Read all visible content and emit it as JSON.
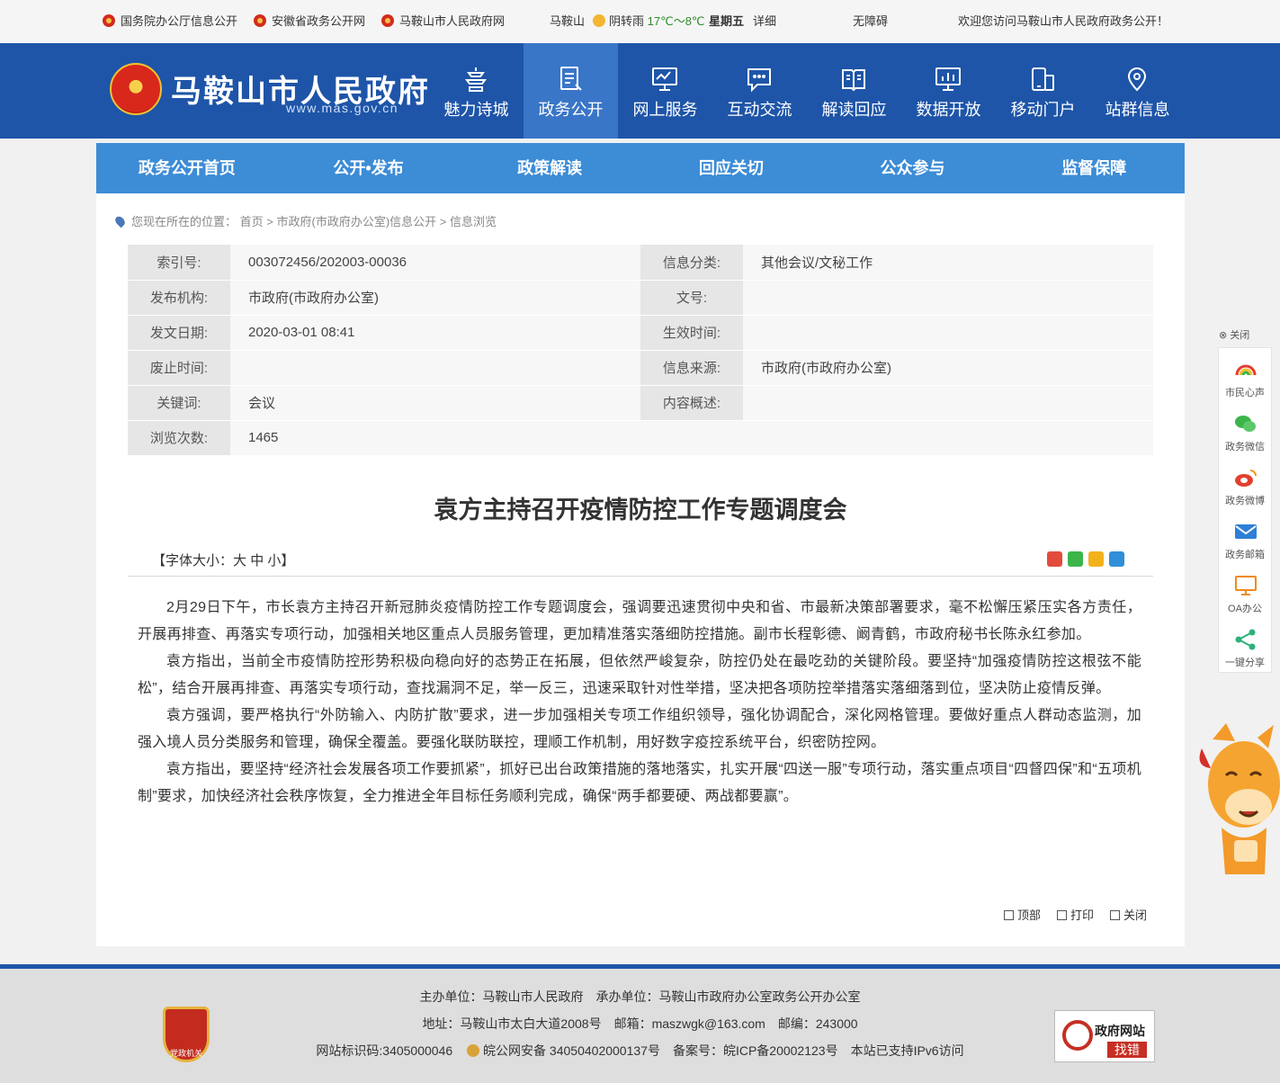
{
  "topbar": {
    "link1": "国务院办公厅信息公开",
    "link2": "安徽省政务公开网",
    "link3": "马鞍山市人民政府网",
    "city": "马鞍山",
    "weather": "阴转雨",
    "temp": "17℃～8℃",
    "weekday": "星期五",
    "detail": "详细",
    "accessibility": "无障碍",
    "welcome": "欢迎您访问马鞍山市人民政府政务公开！"
  },
  "header": {
    "title": "马鞍山市人民政府",
    "url": "www.mas.gov.cn",
    "nav": [
      {
        "label": "魅力诗城"
      },
      {
        "label": "政务公开"
      },
      {
        "label": "网上服务"
      },
      {
        "label": "互动交流"
      },
      {
        "label": "解读回应"
      },
      {
        "label": "数据开放"
      },
      {
        "label": "移动门户"
      },
      {
        "label": "站群信息"
      }
    ],
    "active_index": 1
  },
  "subnav": [
    "政务公开首页",
    "公开•发布",
    "政策解读",
    "回应关切",
    "公众参与",
    "监督保障"
  ],
  "breadcrumb": {
    "prefix": "您现在所在的位置：",
    "items": [
      "首页",
      "市政府(市政府办公室)信息公开",
      "信息浏览"
    ],
    "sep": " > "
  },
  "meta": {
    "rows": [
      {
        "k1": "索引号:",
        "v1": "003072456/202003-00036",
        "k2": "信息分类:",
        "v2": "其他会议/文秘工作"
      },
      {
        "k1": "发布机构:",
        "v1": "市政府(市政府办公室)",
        "k2": "文号:",
        "v2": ""
      },
      {
        "k1": "发文日期:",
        "v1": "2020-03-01 08:41",
        "k2": "生效时间:",
        "v2": ""
      },
      {
        "k1": "废止时间:",
        "v1": "",
        "k2": "信息来源:",
        "v2": "市政府(市政府办公室)"
      },
      {
        "k1": "关键词:",
        "v1": "会议",
        "k2": "内容概述:",
        "v2": ""
      },
      {
        "k1": "浏览次数:",
        "v1": "1465",
        "k2": "",
        "v2": ""
      }
    ]
  },
  "article": {
    "title": "袁方主持召开疫情防控工作专题调度会",
    "fontsize_open": "【字体大小：",
    "fontsize_large": "大",
    "fontsize_medium": "中",
    "fontsize_small": "小",
    "fontsize_close": "】",
    "paragraphs": [
      "2月29日下午，市长袁方主持召开新冠肺炎疫情防控工作专题调度会，强调要迅速贯彻中央和省、市最新决策部署要求，毫不松懈压紧压实各方责任，开展再排查、再落实专项行动，加强相关地区重点人员服务管理，更加精准落实落细防控措施。副市长程彰德、阚青鹤，市政府秘书长陈永红参加。",
      "袁方指出，当前全市疫情防控形势积极向稳向好的态势正在拓展，但依然严峻复杂，防控仍处在最吃劲的关键阶段。要坚持“加强疫情防控这根弦不能松”，结合开展再排查、再落实专项行动，查找漏洞不足，举一反三，迅速采取针对性举措，坚决把各项防控举措落实落细落到位，坚决防止疫情反弹。",
      "袁方强调，要严格执行“外防输入、内防扩散”要求，进一步加强相关专项工作组织领导，强化协调配合，深化网格管理。要做好重点人群动态监测，加强入境人员分类服务和管理，确保全覆盖。要强化联防联控，理顺工作机制，用好数字疫控系统平台，织密防控网。",
      "袁方指出，要坚持“经济社会发展各项工作要抓紧”，抓好已出台政策措施的落地落实，扎实开展“四送一服”专项行动，落实重点项目“四督四保”和“五项机制”要求，加快经济社会秩序恢复，全力推进全年目标任务顺利完成，确保“两手都要硬、两战都要赢”。"
    ],
    "tools": {
      "top": "顶部",
      "print": "打印",
      "close": "关闭"
    }
  },
  "float": {
    "close": "关闭",
    "items": [
      "市民心声",
      "政务微信",
      "政务微博",
      "政务邮箱",
      "OA办公",
      "一键分享"
    ]
  },
  "footer": {
    "line1": "主办单位：马鞍山市人民政府　承办单位：马鞍山市政府办公室政务公开办公室",
    "line2": "地址：马鞍山市太白大道2008号　邮箱：maszwgk@163.com　邮编：243000",
    "line3a": "网站标识码:3405000046",
    "line3b": "皖公网安备 34050402000137号　备案号：皖ICP备20002123号　本站已支持IPv6访问",
    "badge_text": "党政机关",
    "finderr_1": "政府网站",
    "finderr_2": "找错"
  }
}
